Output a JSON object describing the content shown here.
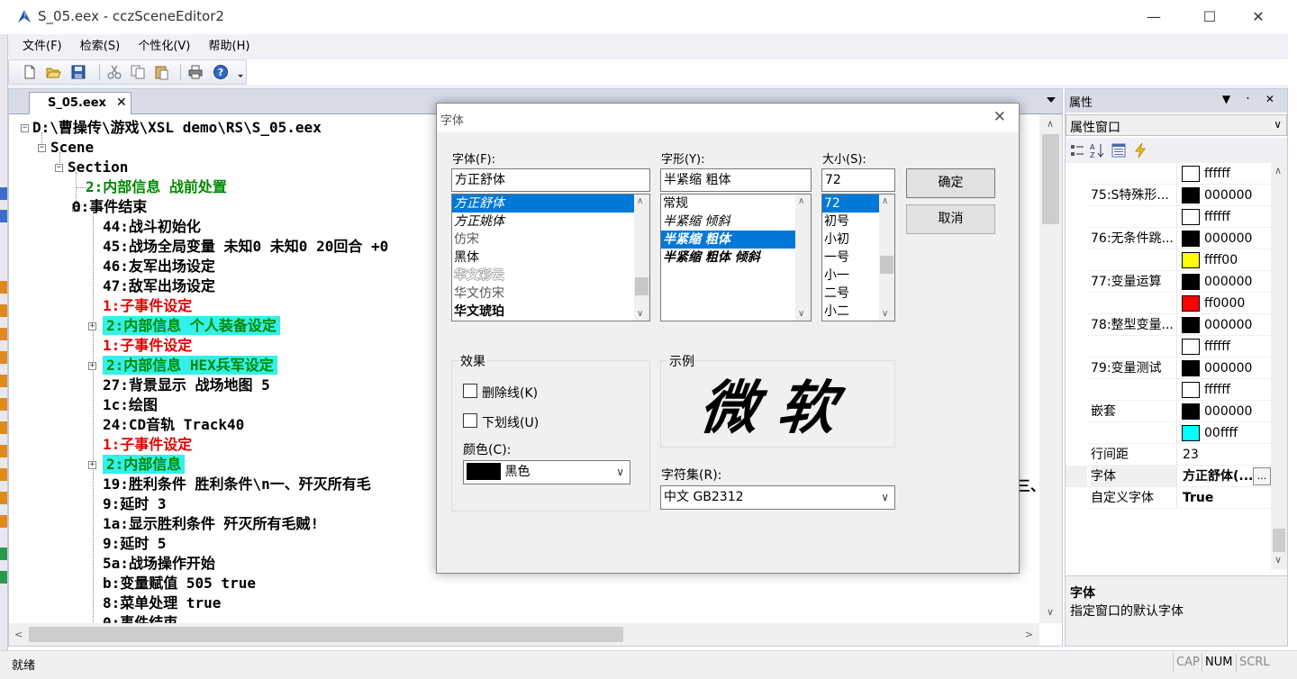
{
  "window": {
    "title": "S_05.eex - cczSceneEditor2",
    "minimize": "—",
    "maximize": "☐",
    "close": "✕"
  },
  "menu": [
    "文件(F)",
    "检索(S)",
    "个性化(V)",
    "帮助(H)"
  ],
  "document": {
    "tab_label": "S_05.eex",
    "tab_close": "✕",
    "tree": [
      {
        "text": "D:\\曹操传\\游戏\\XSL demo\\RS\\S_05.eex",
        "color": "normal",
        "hl": false
      },
      {
        "text": "Scene",
        "color": "normal",
        "hl": false
      },
      {
        "text": "Section",
        "color": "normal",
        "hl": false
      },
      {
        "text": "2:内部信息 战前处置",
        "color": "green",
        "hl": false
      },
      {
        "text": "0:事件结束",
        "color": "normal",
        "hl": false
      },
      {
        "text": "44:战斗初始化",
        "color": "normal",
        "hl": false
      },
      {
        "text": "45:战场全局变量 未知0 未知0 20回合 +0",
        "color": "normal",
        "hl": false
      },
      {
        "text": "46:友军出场设定",
        "color": "normal",
        "hl": false
      },
      {
        "text": "47:敌军出场设定",
        "color": "normal",
        "hl": false
      },
      {
        "text": "1:子事件设定",
        "color": "red",
        "hl": false
      },
      {
        "text": "2:内部信息 个人装备设定",
        "color": "green",
        "hl": true
      },
      {
        "text": "1:子事件设定",
        "color": "red",
        "hl": false
      },
      {
        "text": "2:内部信息 HEX兵军设定",
        "color": "green",
        "hl": true
      },
      {
        "text": "27:背景显示 战场地图 5",
        "color": "normal",
        "hl": false
      },
      {
        "text": "1c:绘图",
        "color": "normal",
        "hl": false
      },
      {
        "text": "24:CD音轨 Track40",
        "color": "normal",
        "hl": false
      },
      {
        "text": "1:子事件设定",
        "color": "red",
        "hl": false
      },
      {
        "text": "2:内部信息",
        "color": "green",
        "hl": true
      },
      {
        "text": "19:胜利条件 胜利条件\\n一、歼灭所有毛",
        "color": "normal",
        "hl": false
      },
      {
        "text": "9:延时 3",
        "color": "normal",
        "hl": false
      },
      {
        "text": "1a:显示胜利条件 歼灭所有毛贼!",
        "color": "normal",
        "hl": false
      },
      {
        "text": "9:延时 5",
        "color": "normal",
        "hl": false
      },
      {
        "text": "5a:战场操作开始",
        "color": "normal",
        "hl": false
      },
      {
        "text": "b:变量赋值 505 true",
        "color": "normal",
        "hl": false
      },
      {
        "text": "8:菜单处理 true",
        "color": "normal",
        "hl": false
      },
      {
        "text": "0:事件结束",
        "color": "normal",
        "hl": false
      }
    ],
    "overflow_text": "三、"
  },
  "properties": {
    "title": "属性",
    "header_buttons": "▼ ᛫ ✕",
    "combo": "属性窗口",
    "rows": [
      {
        "name": "",
        "swatch": "#ffffff",
        "value": "ffffff"
      },
      {
        "name": "75:S特殊形...",
        "swatch": "#000000",
        "value": "000000"
      },
      {
        "name": "",
        "swatch": "#ffffff",
        "value": "ffffff"
      },
      {
        "name": "76:无条件跳...",
        "swatch": "#000000",
        "value": "000000"
      },
      {
        "name": "",
        "swatch": "#ffff00",
        "value": "ffff00"
      },
      {
        "name": "77:变量运算",
        "swatch": "#000000",
        "value": "000000"
      },
      {
        "name": "",
        "swatch": "#ff0000",
        "value": "ff0000"
      },
      {
        "name": "78:整型变量...",
        "swatch": "#000000",
        "value": "000000"
      },
      {
        "name": "",
        "swatch": "#ffffff",
        "value": "ffffff"
      },
      {
        "name": "79:变量测试",
        "swatch": "#000000",
        "value": "000000"
      },
      {
        "name": "",
        "swatch": "#ffffff",
        "value": "ffffff"
      },
      {
        "name": "嵌套",
        "swatch": "#000000",
        "value": "000000"
      },
      {
        "name": "",
        "swatch": "#00ffff",
        "value": "00ffff"
      },
      {
        "name": "行间距",
        "swatch": "",
        "value": "23"
      },
      {
        "name": "字体",
        "swatch": "",
        "value": "方正舒体(..."
      },
      {
        "name": "自定义字体",
        "swatch": "",
        "value": "True"
      }
    ],
    "desc_title": "字体",
    "desc_text": "指定窗口的默认字体"
  },
  "status": {
    "text": "就绪",
    "caps": "CAP",
    "num": "NUM",
    "scrl": "SCRL"
  },
  "font_dialog": {
    "title": "字体",
    "font_label": "字体(F):",
    "font_value": "方正舒体",
    "font_list": [
      "方正舒体",
      "方正姚体",
      "仿宋",
      "黑体",
      "华文彩云",
      "华文仿宋",
      "华文琥珀"
    ],
    "font_selected_index": 0,
    "style_label": "字形(Y):",
    "style_value": "半紧缩 粗体",
    "style_list": [
      "常规",
      "半紧缩 倾斜",
      "半紧缩 粗体",
      "半紧缩 粗体 倾斜"
    ],
    "style_selected_index": 2,
    "size_label": "大小(S):",
    "size_value": "72",
    "size_list": [
      "72",
      "初号",
      "小初",
      "一号",
      "小一",
      "二号",
      "小二"
    ],
    "size_selected_index": 0,
    "ok": "确定",
    "cancel": "取消",
    "effects_label": "效果",
    "strike_label": "删除线(K)",
    "underline_label": "下划线(U)",
    "color_label": "颜色(C):",
    "color_value": "黑色",
    "sample_label": "示例",
    "sample_text": "微软",
    "charset_label": "字符集(R):",
    "charset_value": "中文 GB2312"
  }
}
